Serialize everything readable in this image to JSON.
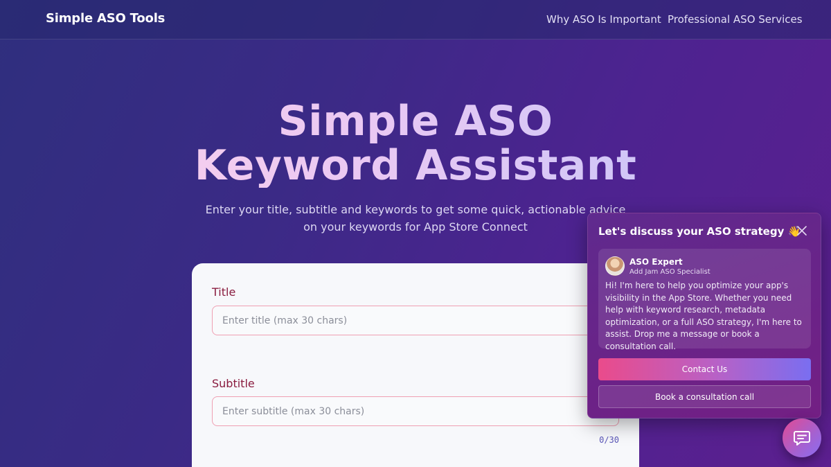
{
  "header": {
    "brand": "Simple ASO Tools",
    "nav": {
      "why": "Why ASO Is Important",
      "pro": "Professional ASO Services"
    }
  },
  "hero": {
    "title_line1": "Simple ASO",
    "title_line2": "Keyword Assistant",
    "subtitle": "Enter your title, subtitle and keywords to get some quick, actionable advice on your keywords for App Store Connect"
  },
  "form": {
    "title_label": "Title",
    "title_placeholder": "Enter title (max 30 chars)",
    "subtitle_label": "Subtitle",
    "subtitle_placeholder": "Enter subtitle (max 30 chars)",
    "subtitle_counter": "0/30"
  },
  "chat": {
    "heading": "Let's discuss your ASO strategy 👋",
    "agent_name": "ASO Expert",
    "agent_role": "Add Jam ASO Specialist",
    "message": "Hi! I'm here to help you optimize your app's visibility in the App Store. Whether you need help with keyword research, metadata optimization, or a full ASO strategy, I'm here to assist. Drop me a message or book a consultation call.",
    "contact_label": "Contact Us",
    "book_label": "Book a consultation call"
  },
  "icons": {
    "close": "close-icon",
    "chat": "chat-bubble-icon"
  },
  "colors": {
    "accent_pink": "#ea4b8b",
    "accent_purple": "#7a6ef0",
    "label_red": "#8a1c3f"
  }
}
